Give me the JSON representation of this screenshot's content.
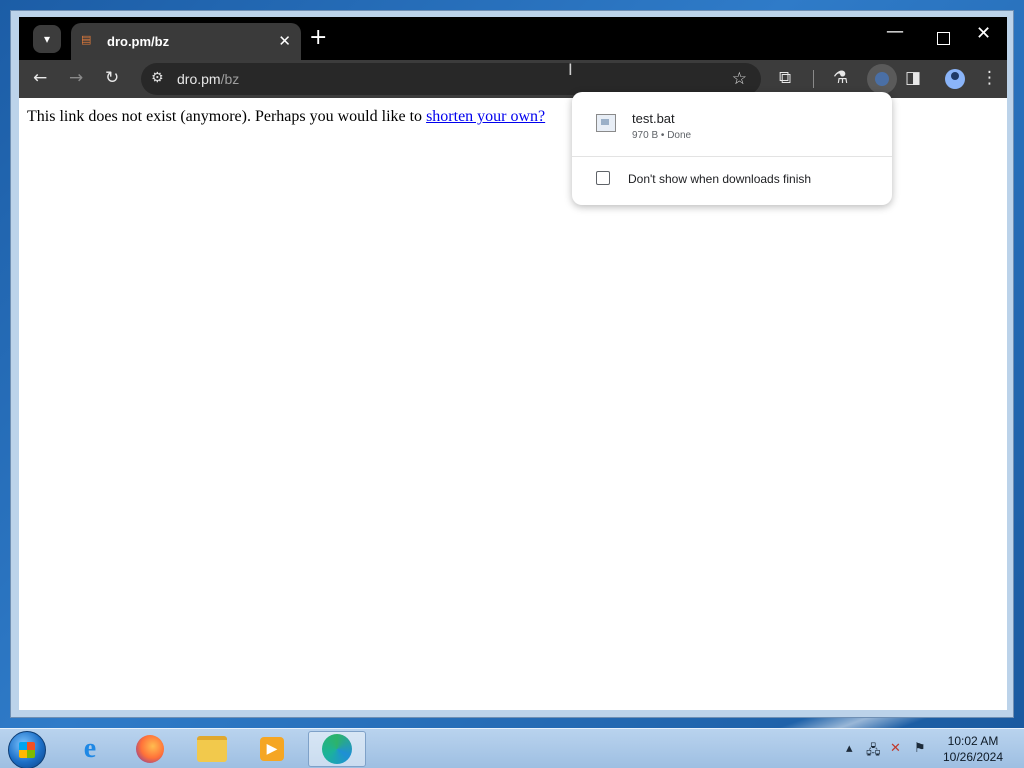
{
  "browser": {
    "tab": {
      "title": "dro.pm/bz",
      "close": "✕"
    },
    "new_tab": "+",
    "address_bar": {
      "host": "dro.pm",
      "path": "/bz"
    },
    "window_controls": {
      "minimize": "—",
      "close": "✕"
    },
    "icons": [
      "tab-search-icon",
      "back-icon",
      "forward-icon",
      "reload-icon",
      "site-info-icon",
      "bookmark-star-icon",
      "extensions-icon",
      "labs-icon",
      "downloads-icon",
      "side-panel-icon",
      "profile-icon",
      "menu-icon"
    ]
  },
  "page": {
    "message": "This link does not exist (anymore). Perhaps you would like to ",
    "link_text": "shorten your own?"
  },
  "downloads_bubble": {
    "file_name": "test.bat",
    "file_meta": "970 B • Done",
    "checkbox_label": "Don't show when downloads finish"
  },
  "taskbar": {
    "apps": [
      "Internet Explorer",
      "Firefox",
      "Windows Explorer",
      "Windows Media Player",
      "Microsoft Edge"
    ],
    "time": "10:02 AM",
    "date": "10/26/2024"
  }
}
